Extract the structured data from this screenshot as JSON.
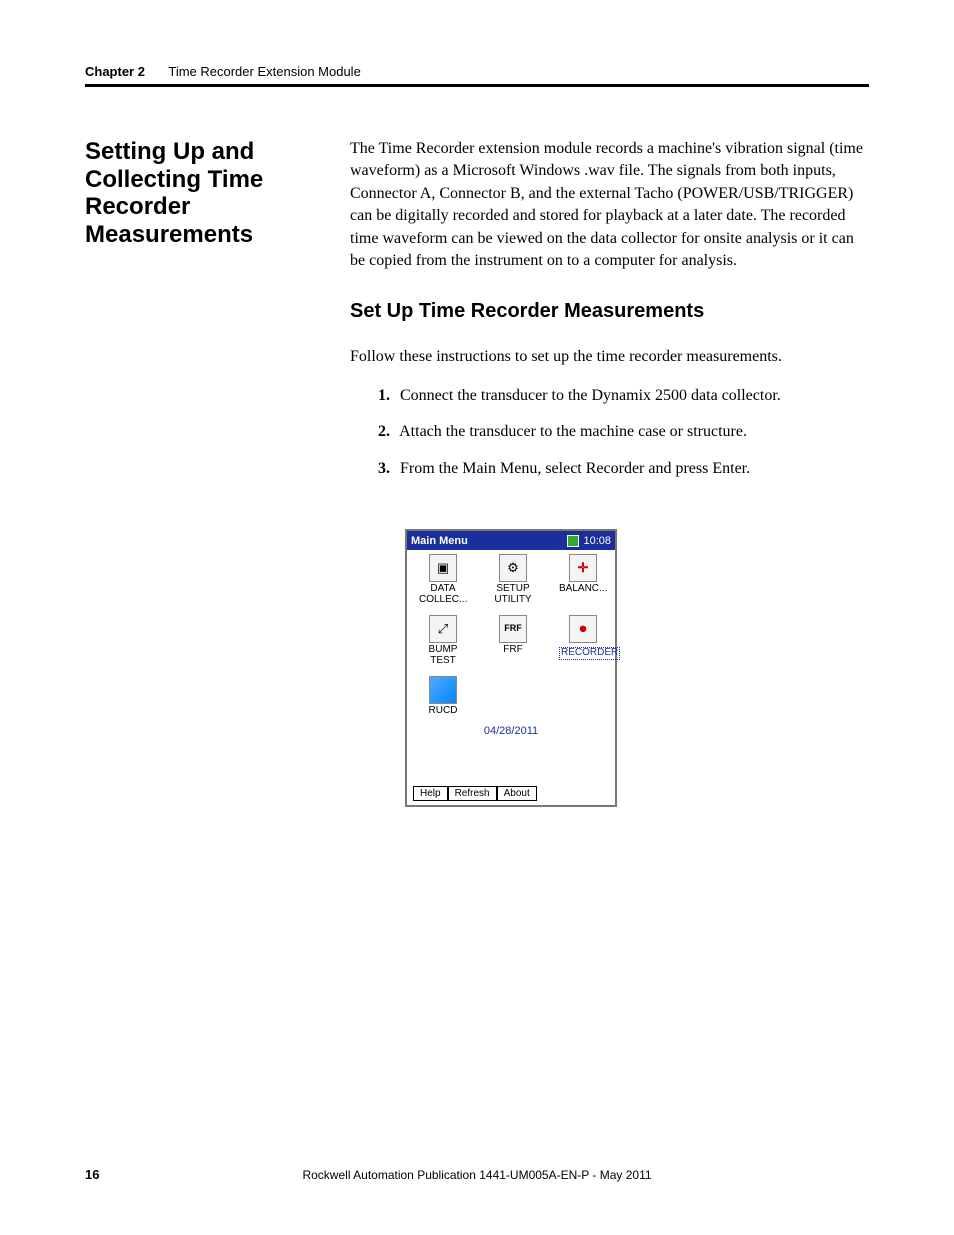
{
  "header": {
    "chapter": "Chapter 2",
    "title": "Time Recorder Extension Module"
  },
  "section": {
    "title": "Setting Up and Collecting Time Recorder Measurements",
    "intro": "The Time Recorder extension module records a machine's vibration signal (time waveform) as a Microsoft Windows .wav file. The signals from both inputs, Connector A, Connector B, and the external Tacho (POWER/USB/TRIGGER) can be digitally recorded and stored for playback at a later date. The recorded time waveform can be viewed on the data collector for onsite analysis or it can be copied from the instrument on to a computer for analysis.",
    "subheading": "Set Up Time Recorder Measurements",
    "follow": "Follow these instructions to set up the time recorder measurements.",
    "steps": [
      "Connect the transducer to the Dynamix 2500 data collector.",
      "Attach the transducer to the machine case or structure.",
      "From the Main Menu, select Recorder and press Enter."
    ]
  },
  "device": {
    "title": "Main Menu",
    "time": "10:08",
    "apps": {
      "r1": [
        {
          "label": "DATA COLLEC...",
          "glyph": "▣"
        },
        {
          "label": "SETUP UTILITY",
          "glyph": "⚙"
        },
        {
          "label": "BALANC...",
          "glyph": "✛"
        }
      ],
      "r2": [
        {
          "label": "BUMP TEST",
          "glyph": "⤢"
        },
        {
          "label": "FRF",
          "glyph": "FRF"
        },
        {
          "label": "RECORDER",
          "glyph": "⏺"
        }
      ],
      "r3": [
        {
          "label": "RUCD",
          "glyph": ""
        }
      ]
    },
    "date": "04/28/2011",
    "softkeys": [
      "Help",
      "Refresh",
      "About"
    ]
  },
  "footer": {
    "page": "16",
    "pub": "Rockwell Automation Publication 1441-UM005A-EN-P - May 2011"
  }
}
